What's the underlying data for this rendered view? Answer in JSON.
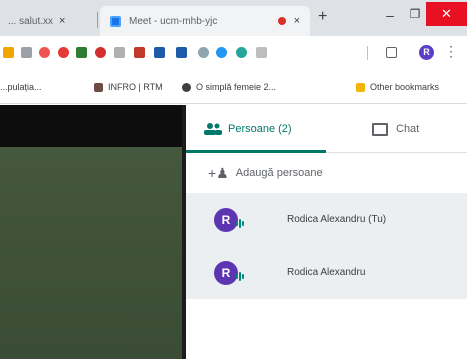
{
  "browser": {
    "tabs": [
      {
        "title": "... salut.xx",
        "close": "×"
      },
      {
        "title": "Meet - ucm-mhb-yjc",
        "close": "×"
      }
    ],
    "new_tab": "+",
    "window_controls": {
      "minimize": "–",
      "maximize": "❐",
      "close": "✕"
    },
    "profile_initial": "R",
    "menu": "⋮"
  },
  "bookmarks": [
    {
      "label": "...pulația...",
      "icon_color": "#f4b400"
    },
    {
      "label": "INFRO | RTM",
      "icon_color": "#6d4c41"
    },
    {
      "label": "O simplă femeie 2...",
      "icon_color": "#3c4043"
    },
    {
      "label": "Other bookmarks",
      "icon_color": "#f4b400"
    }
  ],
  "people_panel": {
    "people_tab": "Persoane (2)",
    "chat_tab": "Chat",
    "add_people": "Adaugă persoane",
    "accent_color": "#00796b",
    "participants": [
      {
        "initial": "R",
        "name": "Rodica Alexandru (Tu)"
      },
      {
        "initial": "R",
        "name": "Rodica Alexandru"
      }
    ]
  }
}
